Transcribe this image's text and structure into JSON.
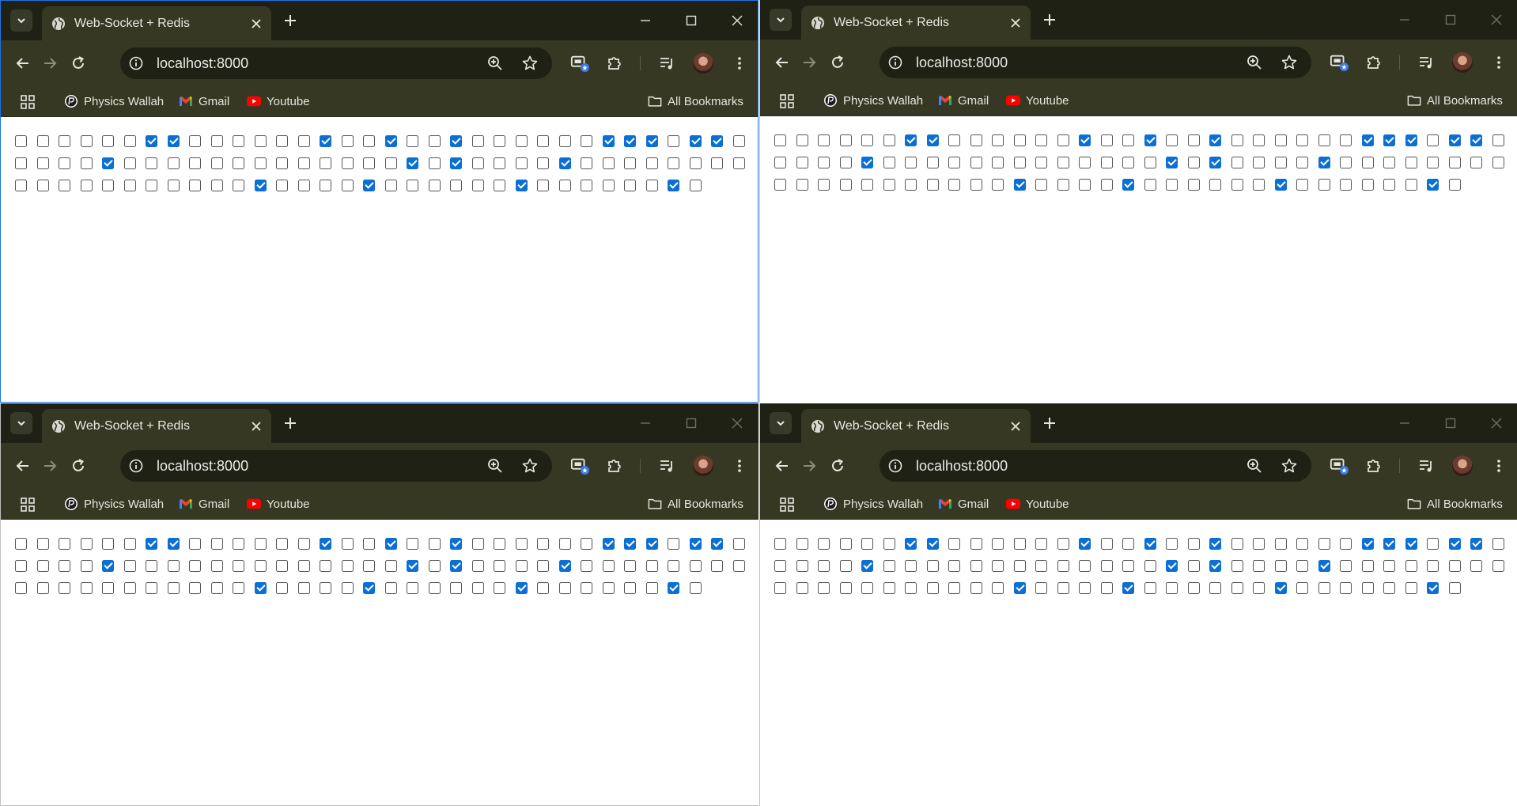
{
  "windows": [
    {
      "id": "w1",
      "active": true
    },
    {
      "id": "w2",
      "active": false
    },
    {
      "id": "w3",
      "active": false
    },
    {
      "id": "w4",
      "active": false
    }
  ],
  "browser": {
    "tab_title": "Web-Socket + Redis",
    "url": "localhost:8000",
    "bookmarks": [
      {
        "label": "Physics Wallah",
        "icon": "physics-wallah-icon"
      },
      {
        "label": "Gmail",
        "icon": "gmail-icon"
      },
      {
        "label": "Youtube",
        "icon": "youtube-icon"
      }
    ],
    "all_bookmarks_label": "All Bookmarks"
  },
  "colors": {
    "frame": "#1f2115",
    "toolbar": "#363823",
    "checkbox_checked": "#0b6fd4"
  },
  "checkboxes": {
    "row_lengths": [
      34,
      34,
      32
    ],
    "checked": [
      [
        6,
        7,
        14,
        17,
        20,
        27,
        28,
        29,
        31,
        32
      ],
      [
        4,
        18,
        20,
        25
      ],
      [
        11,
        16,
        23,
        30
      ]
    ]
  }
}
